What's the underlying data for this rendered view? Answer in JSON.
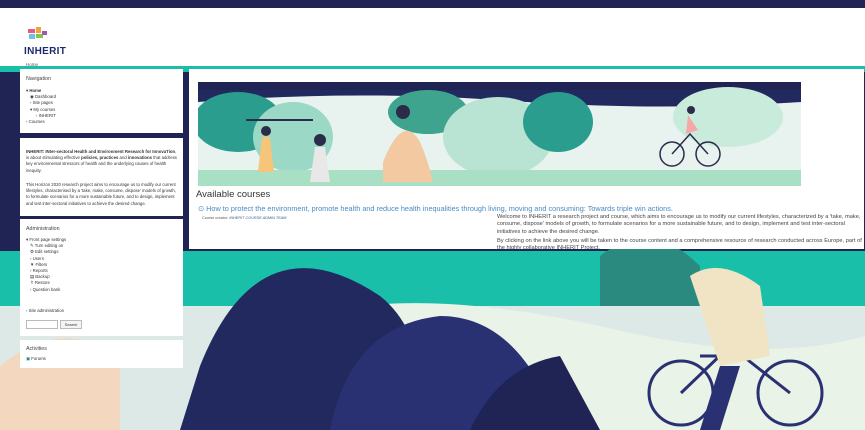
{
  "header": {
    "brand": "INHERIT",
    "breadcrumb": "Home"
  },
  "navigation": {
    "title": "Navigation",
    "items": [
      "Home",
      "Dashboard",
      "Site pages",
      "My courses",
      "INHERIT",
      "Courses"
    ]
  },
  "intro": {
    "p1_bold": "INHERIT: INter-sectoral Health and Environment Research for InnovaTion",
    "p1_rest": ", is about stimulating effective ",
    "p1_bold2": "policies, practices",
    "p1_mid": " and ",
    "p1_bold3": "innovations",
    "p1_end": " that address key environmental stressors of health and the underlying causes of health inequity.",
    "p2": "This Horizon 2020 research project aims to encourage us to modify our current lifestyles, characterised by a 'take, make, consume, dispose' models of growth, to formulate scenarios for a more sustainable future, and to design, implement and test inter-sectoral initiatives to achieve the desired change."
  },
  "admin": {
    "title": "Administration",
    "items": [
      "Front page settings",
      "Turn editing on",
      "Edit settings",
      "Users",
      "Filters",
      "Reports",
      "Backup",
      "Restore",
      "Question bank"
    ],
    "site_admin": "Site administration",
    "search_button": "Search"
  },
  "activities": {
    "title": "Activities",
    "forums": "Forums"
  },
  "main": {
    "available": "Available courses",
    "course_title": "How to protect the environment, promote health and reduce health inequalities through living, moving and consuming: Towards triple win actions.",
    "creator_label": "Course creator: ",
    "creator_name": "INHERIT COURSE ADMIN TEAM",
    "summary1": "Welcome to INHERIT a research project and course, which aims to encourage us to modify our current lifestyles, characterized by a 'take, make, consume, dispose' models of growth, to formulate scenarios for a more sustainable future, and to design, implement and test inter-sectoral initiatives to achieve the desired change.",
    "summary2": "By clicking on the link above you will be taken to the course content and a comprehensive resource of research conducted across Europe, part of the highly collaborative INHERIT Project."
  },
  "colors": {
    "navy": "#1f2454",
    "teal": "#19bfa8",
    "link": "#2a5f8f"
  }
}
